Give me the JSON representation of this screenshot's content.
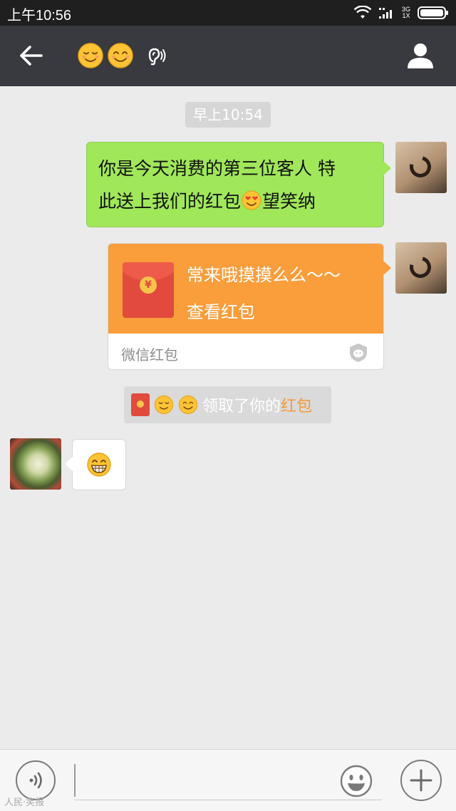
{
  "status_bar": {
    "time": "上午10:56",
    "network_top": "3G",
    "network_bottom": "1X"
  },
  "header": {
    "back_icon": "arrow-left-icon",
    "title_emojis": [
      "relieved-face",
      "smiling-face"
    ],
    "earpiece_icon": "ear-icon",
    "profile_icon": "person-icon"
  },
  "chat": {
    "timestamp": "早上10:54",
    "messages": [
      {
        "side": "right",
        "type": "text",
        "line1": "你是今天消费的第三位客人 特",
        "line2_before_emoji": "此送上我们的红包",
        "emoji": "heart-eyes-face",
        "line2_after_emoji": "望笑纳"
      },
      {
        "side": "right",
        "type": "red-packet",
        "greeting": "常来哦摸摸么么～～",
        "action": "查看红包",
        "footer": "微信红包",
        "coin_symbol": "¥"
      },
      {
        "type": "system",
        "text": "领取了你的",
        "link": "红包"
      },
      {
        "side": "left",
        "type": "emoji",
        "emoji": "grinning-face"
      }
    ]
  },
  "bottom_bar": {
    "voice_icon": "voice-icon",
    "emoji_icon": "smiley-icon",
    "plus_icon": "plus-icon"
  },
  "watermark": "人民·笑报",
  "colors": {
    "header_bg": "#393a3f",
    "chat_bg": "#ebebeb",
    "bubble_green": "#a0e75a",
    "red_packet": "#fa9d3b",
    "link_orange": "#f39b3a"
  }
}
